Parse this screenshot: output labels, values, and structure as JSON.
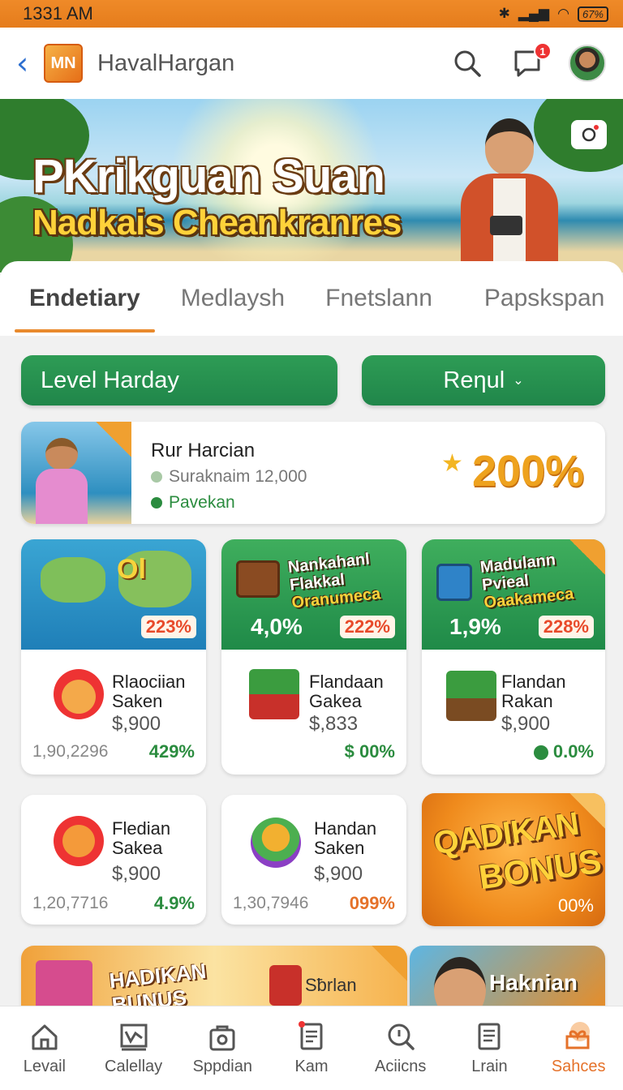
{
  "status": {
    "time": "1331 AM",
    "battery": "67%"
  },
  "header": {
    "logo": "MN",
    "title": "HavalHargan",
    "notif_count": "1"
  },
  "banner": {
    "title": "PKrikguan Suan",
    "subtitle": "Nadkais Cheankranres"
  },
  "tabs": [
    "Endetiary",
    "Medlaysh",
    "Fnetslann",
    "Papskspan"
  ],
  "filters": {
    "level": "Level Harday",
    "sort": "Reƞul"
  },
  "featured": {
    "name": "Rur Harcian",
    "sub": "Suraknaim 12,000",
    "tag": "Pavekan",
    "percent": "200%"
  },
  "promos": [
    {
      "map_label": "Ol",
      "rate": "223%"
    },
    {
      "t1": "Nankahanl",
      "t2": "Flakkal",
      "t3": "Oranumeca",
      "rate1": "4,0%",
      "rate2": "222%"
    },
    {
      "t1": "Madulann",
      "t2": "Pvieal",
      "t3": "Oaakameca",
      "rate1": "1,9%",
      "rate2": "228%"
    }
  ],
  "items_row1": [
    {
      "name1": "Rlaociian",
      "name2": "Saken",
      "price": "$,900",
      "count": "1,90,2296",
      "pct": "429%"
    },
    {
      "name1": "Flandaan",
      "name2": "Gakea",
      "price": "$,833",
      "count": "",
      "pct": "$ 00%"
    },
    {
      "name1": "Flandan",
      "name2": "Rakan",
      "price": "$,900",
      "count": "",
      "pct": "0.0%"
    }
  ],
  "items_row2": [
    {
      "name1": "Fledian",
      "name2": "Sakea",
      "price": "$,900",
      "count": "1,20,7716",
      "pct": "4.9%"
    },
    {
      "name1": "Handan",
      "name2": "Saken",
      "price": "$,900",
      "count": "1,30,7946",
      "pct": "099%"
    }
  ],
  "bonus": {
    "line1": "QADIKAN",
    "line2": "BONUS",
    "pct": "00%"
  },
  "row3": [
    {
      "line1": "HADIKAN",
      "line2": "BUNUS",
      "label": "Sƀrlan"
    },
    {
      "label": "Haknian"
    }
  ],
  "nav": [
    "Levail",
    "Calellay",
    "Sppdian",
    "Kam",
    "Aciicns",
    "Lrain",
    "Sahces"
  ],
  "colors": {
    "accent": "#e98a2d",
    "green": "#2e9c55",
    "orange": "#e5722a"
  }
}
